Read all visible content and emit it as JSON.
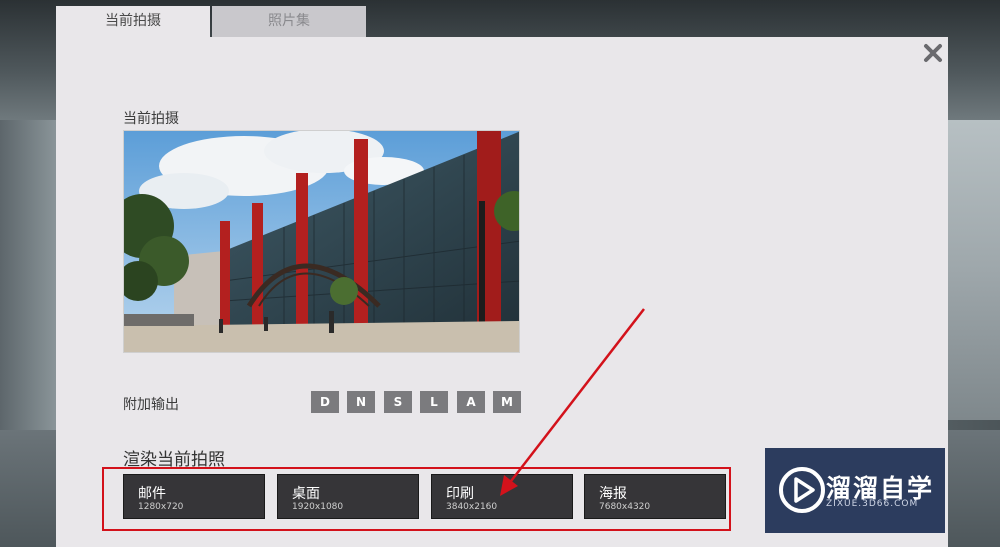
{
  "tabs": [
    {
      "label": "当前拍摄",
      "active": true
    },
    {
      "label": "照片集",
      "active": false
    }
  ],
  "current_shot": {
    "label": "当前拍摄"
  },
  "extra_output": {
    "label": "附加输出",
    "buttons": [
      "D",
      "N",
      "S",
      "L",
      "A",
      "M"
    ]
  },
  "render": {
    "heading": "渲染当前拍照",
    "options": [
      {
        "name": "邮件",
        "resolution": "1280x720"
      },
      {
        "name": "桌面",
        "resolution": "1920x1080"
      },
      {
        "name": "印刷",
        "resolution": "3840x2160"
      },
      {
        "name": "海报",
        "resolution": "7680x4320"
      }
    ]
  },
  "watermark": {
    "title": "溜溜自学",
    "subtitle": "ZIXUE.3D66.COM"
  },
  "colors": {
    "panel": "#e9e7ea",
    "button": "#363538",
    "highlight": "#d3121b",
    "mini_button": "#7b7b7e"
  }
}
